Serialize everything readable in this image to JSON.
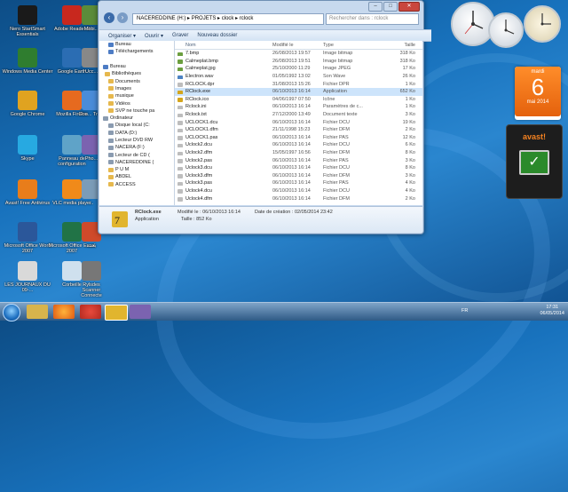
{
  "desktop": {
    "icons": [
      {
        "label": "Nero StartSmart Essentials",
        "color": "#1a1a1a"
      },
      {
        "label": "Adobe Reader 9",
        "color": "#c8281e"
      },
      {
        "label": "Mobi...",
        "color": "#5b8c3a"
      },
      {
        "label": "Windows Media Center",
        "color": "#2f7d2f"
      },
      {
        "label": "Google Earth",
        "color": "#2b6db3"
      },
      {
        "label": "Ucc...",
        "color": "#888888"
      },
      {
        "label": "Google Chrome",
        "color": "#e0a320"
      },
      {
        "label": "Mozilla Firefox",
        "color": "#e66a1f"
      },
      {
        "label": "Goo... Tra...",
        "color": "#4a8cd8"
      },
      {
        "label": "Skype",
        "color": "#27a9e1"
      },
      {
        "label": "Panneau de configuration",
        "color": "#5fa3c8"
      },
      {
        "label": "Pho...",
        "color": "#7b63b0"
      },
      {
        "label": "Avast! Free Antivirus",
        "color": "#e87d1b"
      },
      {
        "label": "VLC media player",
        "color": "#f08a1a"
      },
      {
        "label": "...",
        "color": "#7b9cb8"
      },
      {
        "label": "Microsoft Office Word 2007",
        "color": "#2b579a"
      },
      {
        "label": "Microsoft Office Excel 2007",
        "color": "#217346"
      },
      {
        "label": "بحث",
        "color": "#cf4a2a"
      },
      {
        "label": "LES JOURNAUX DU 09-...",
        "color": "#d9d9d9"
      },
      {
        "label": "Corbeille",
        "color": "#cfe0ee"
      },
      {
        "label": "Rylsdes Scanner Connecte",
        "color": "#777777"
      }
    ]
  },
  "window": {
    "path": [
      "NACEREDDINE (H:)",
      "PROJETS",
      "clock",
      "rclock"
    ],
    "search_placeholder": "Rechercher dans : rclock",
    "toolbar": {
      "organize": "Organiser ▾",
      "open": "Ouvrir ▾",
      "burn": "Graver",
      "new_folder": "Nouveau dossier"
    },
    "columns": {
      "name": "Nom",
      "date": "Modifié le",
      "type": "Type",
      "size": "Taille"
    },
    "nav": [
      {
        "label": "Bureau",
        "color": "#4d7cc4"
      },
      {
        "label": "Téléchargements",
        "color": "#4d7cc4"
      },
      {
        "label": "",
        "color": "#ffffff"
      },
      {
        "label": "Bureau",
        "color": "#4d7cc4"
      },
      {
        "label": "Bibliothèques",
        "color": "#e6b84d"
      },
      {
        "label": "Documents",
        "color": "#e6b84d"
      },
      {
        "label": "Images",
        "color": "#e6b84d"
      },
      {
        "label": "musique",
        "color": "#e6b84d"
      },
      {
        "label": "Vidéos",
        "color": "#e6b84d"
      },
      {
        "label": "SVP ne touche pa",
        "color": "#e6b84d"
      },
      {
        "label": "Ordinateur",
        "color": "#8a9bb0"
      },
      {
        "label": "Disque local (C:",
        "color": "#8a9bb0"
      },
      {
        "label": "DATA (D:)",
        "color": "#8a9bb0"
      },
      {
        "label": "Lecteur DVD RW",
        "color": "#8a9bb0"
      },
      {
        "label": "NACERA (F:)",
        "color": "#8a9bb0"
      },
      {
        "label": "Lecteur de CD (",
        "color": "#8a9bb0"
      },
      {
        "label": "NACEREDDINE (",
        "color": "#8a9bb0"
      },
      {
        "label": "P U M",
        "color": "#e6b84d"
      },
      {
        "label": "ABDEL",
        "color": "#e6b84d"
      },
      {
        "label": "ACCESS",
        "color": "#e6b84d"
      }
    ],
    "files": [
      {
        "name": "7.bmp",
        "date": "26/08/2013 19:57",
        "type": "Image bitmap",
        "size": "318 Ko",
        "color": "#6b9e3f"
      },
      {
        "name": "Calmeplat.bmp",
        "date": "26/08/2013 19:51",
        "type": "Image bitmap",
        "size": "318 Ko",
        "color": "#6b9e3f"
      },
      {
        "name": "Calmeplat.jpg",
        "date": "25/10/2000 11:29",
        "type": "Image JPEG",
        "size": "17 Ko",
        "color": "#6b9e3f"
      },
      {
        "name": "Electron.wav",
        "date": "01/05/1992 13:02",
        "type": "Son Wave",
        "size": "26 Ko",
        "color": "#4c82c3"
      },
      {
        "name": "RCLOCK.dpr",
        "date": "31/08/2013 15:26",
        "type": "Fichier DPR",
        "size": "1 Ko",
        "color": "#bdbdbd"
      },
      {
        "name": "RClock.exe",
        "date": "06/10/2013 16:14",
        "type": "Application",
        "size": "652 Ko",
        "color": "#d4a51c"
      },
      {
        "name": "RClock.ico",
        "date": "04/06/1997 07:50",
        "type": "Icône",
        "size": "1 Ko",
        "color": "#d4a51c"
      },
      {
        "name": "Rclock.ini",
        "date": "06/10/2013 16:14",
        "type": "Paramètres de c...",
        "size": "1 Ko",
        "color": "#bdbdbd"
      },
      {
        "name": "Rclock.txt",
        "date": "27/12/2000 13:49",
        "type": "Document texte",
        "size": "3 Ko",
        "color": "#bdbdbd"
      },
      {
        "name": "UCLOCK1.dcu",
        "date": "06/10/2013 16:14",
        "type": "Fichier DCU",
        "size": "19 Ko",
        "color": "#bdbdbd"
      },
      {
        "name": "UCLOCK1.dfm",
        "date": "21/11/1998 15:23",
        "type": "Fichier DFM",
        "size": "2 Ko",
        "color": "#bdbdbd"
      },
      {
        "name": "UCLOCK1.pas",
        "date": "06/10/2013 16:14",
        "type": "Fichier PAS",
        "size": "12 Ko",
        "color": "#bdbdbd"
      },
      {
        "name": "Uclock2.dcu",
        "date": "06/10/2013 16:14",
        "type": "Fichier DCU",
        "size": "6 Ko",
        "color": "#bdbdbd"
      },
      {
        "name": "Uclock2.dfm",
        "date": "15/05/1997 16:56",
        "type": "Fichier DFM",
        "size": "8 Ko",
        "color": "#bdbdbd"
      },
      {
        "name": "Uclock2.pas",
        "date": "06/10/2013 16:14",
        "type": "Fichier PAS",
        "size": "3 Ko",
        "color": "#bdbdbd"
      },
      {
        "name": "Uclock3.dcu",
        "date": "06/10/2013 16:14",
        "type": "Fichier DCU",
        "size": "8 Ko",
        "color": "#bdbdbd"
      },
      {
        "name": "Uclock3.dfm",
        "date": "06/10/2013 16:14",
        "type": "Fichier DFM",
        "size": "3 Ko",
        "color": "#bdbdbd"
      },
      {
        "name": "Uclock3.pas",
        "date": "06/10/2013 16:14",
        "type": "Fichier PAS",
        "size": "4 Ko",
        "color": "#bdbdbd"
      },
      {
        "name": "Uclock4.dcu",
        "date": "06/10/2013 16:14",
        "type": "Fichier DCU",
        "size": "4 Ko",
        "color": "#bdbdbd"
      },
      {
        "name": "Uclock4.dfm",
        "date": "06/10/2013 16:14",
        "type": "Fichier DFM",
        "size": "2 Ko",
        "color": "#bdbdbd"
      }
    ],
    "selected_index": 5,
    "details": {
      "name": "RClock.exe",
      "modified": "Modifié le : 06/10/2013 16:14",
      "created": "Date de création : 02/05/2014 23:42",
      "type": "Application",
      "size": "Taille : 852 Ko"
    }
  },
  "gadgets": {
    "calendar": {
      "weekday": "mardi",
      "day": "6",
      "month_year": "mai 2014"
    },
    "avast_label": "avast!"
  },
  "taskbar": {
    "time": "17:31",
    "date": "06/05/2014",
    "lang": "FR"
  }
}
